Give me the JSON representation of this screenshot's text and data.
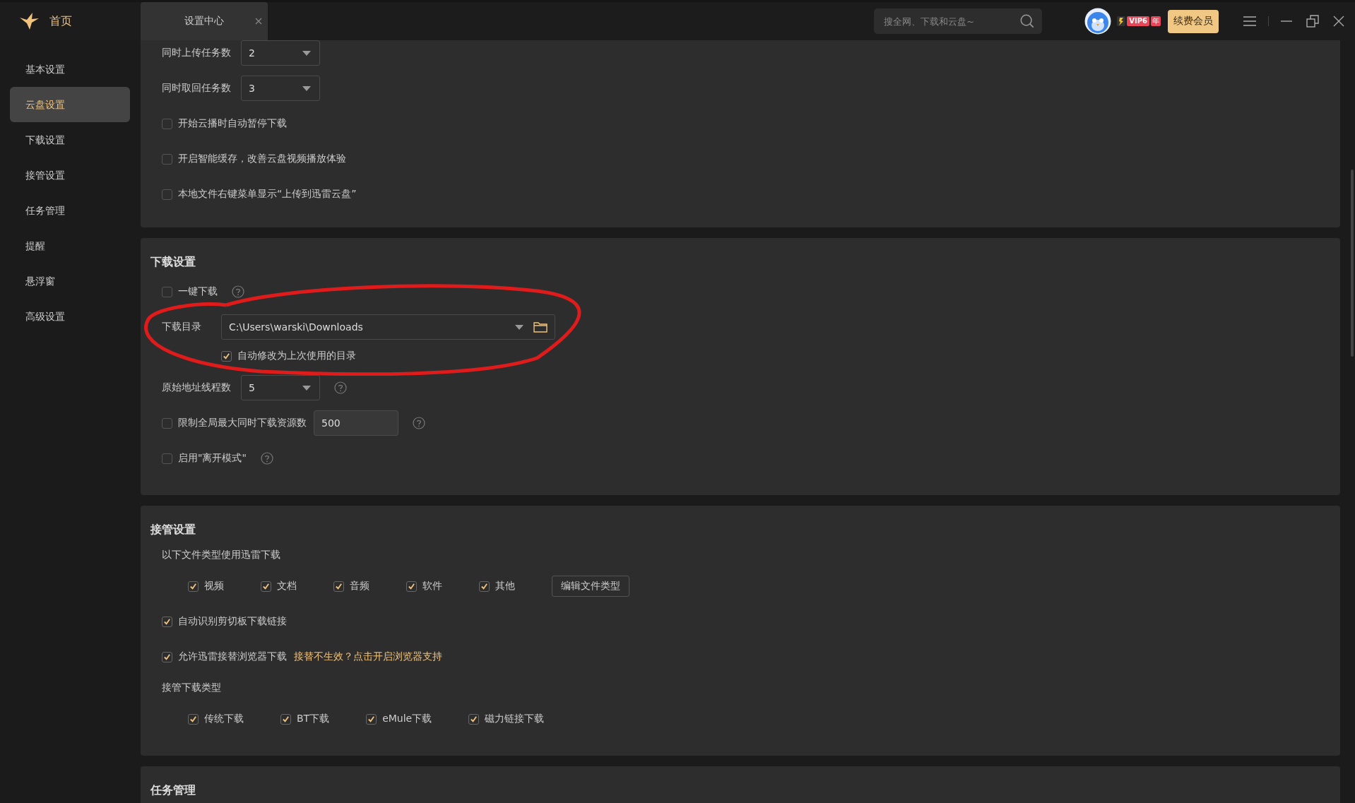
{
  "app": {
    "home_label": "首页"
  },
  "tabs": [
    {
      "label": "设置中心",
      "selected": true
    }
  ],
  "search": {
    "placeholder": "搜全网、下载和云盘~"
  },
  "vip": {
    "level": "VIP6",
    "term": "年"
  },
  "renew_button": "续费会员",
  "sidebar": {
    "items": [
      {
        "label": "基本设置",
        "selected": false
      },
      {
        "label": "云盘设置",
        "selected": true
      },
      {
        "label": "下载设置",
        "selected": false
      },
      {
        "label": "接管设置",
        "selected": false
      },
      {
        "label": "任务管理",
        "selected": false
      },
      {
        "label": "提醒",
        "selected": false
      },
      {
        "label": "悬浮窗",
        "selected": false
      },
      {
        "label": "高级设置",
        "selected": false
      }
    ]
  },
  "sections": [
    {
      "rows": [
        {
          "kind": "select",
          "label": "同时上传任务数",
          "value": "2"
        },
        {
          "kind": "select",
          "label": "同时取回任务数",
          "value": "3"
        },
        {
          "kind": "checkbox",
          "label": "开始云播时自动暂停下载",
          "checked": false
        },
        {
          "kind": "checkbox",
          "label": "开启智能缓存，改善云盘视频播放体验",
          "checked": false
        },
        {
          "kind": "checkbox",
          "label": "本地文件右键菜单显示“上传到迅雷云盘”",
          "checked": false
        }
      ]
    },
    {
      "title": "下载设置",
      "rows": [
        {
          "kind": "checkbox",
          "label": "一键下载",
          "checked": false,
          "help": true
        },
        {
          "kind": "path",
          "label": "下载目录",
          "value": "C:\\Users\\warski\\Downloads",
          "option": {
            "label": "自动修改为上次使用的目录",
            "checked": true
          }
        },
        {
          "kind": "select",
          "label": "原始地址线程数",
          "value": "5",
          "help": true
        },
        {
          "kind": "checkbox_input",
          "label": "限制全局最大同时下载资源数",
          "checked": false,
          "value": "500",
          "help": true
        },
        {
          "kind": "checkbox",
          "label": "启用\"离开模式\"",
          "checked": false,
          "help": true
        }
      ]
    },
    {
      "title": "接管设置",
      "rows": [
        {
          "kind": "heading",
          "label": "以下文件类型使用迅雷下载"
        },
        {
          "kind": "options",
          "items": [
            {
              "label": "视频",
              "checked": true
            },
            {
              "label": "文档",
              "checked": true
            },
            {
              "label": "音频",
              "checked": true
            },
            {
              "label": "软件",
              "checked": true
            },
            {
              "label": "其他",
              "checked": true
            }
          ],
          "button": "编辑文件类型"
        },
        {
          "kind": "checkbox",
          "label": "自动识别剪切板下载链接",
          "checked": true
        },
        {
          "kind": "checkbox",
          "label": "允许迅雷接替浏览器下载",
          "checked": true,
          "link": "接替不生效？点击开启浏览器支持"
        },
        {
          "kind": "heading",
          "label": "接管下载类型"
        },
        {
          "kind": "options",
          "items": [
            {
              "label": "传统下载",
              "checked": true
            },
            {
              "label": "BT下载",
              "checked": true
            },
            {
              "label": "eMule下载",
              "checked": true
            },
            {
              "label": "磁力链接下载",
              "checked": true
            }
          ]
        }
      ]
    },
    {
      "title": "任务管理"
    }
  ],
  "markup": [
    {
      "kind": "ellipse"
    }
  ]
}
